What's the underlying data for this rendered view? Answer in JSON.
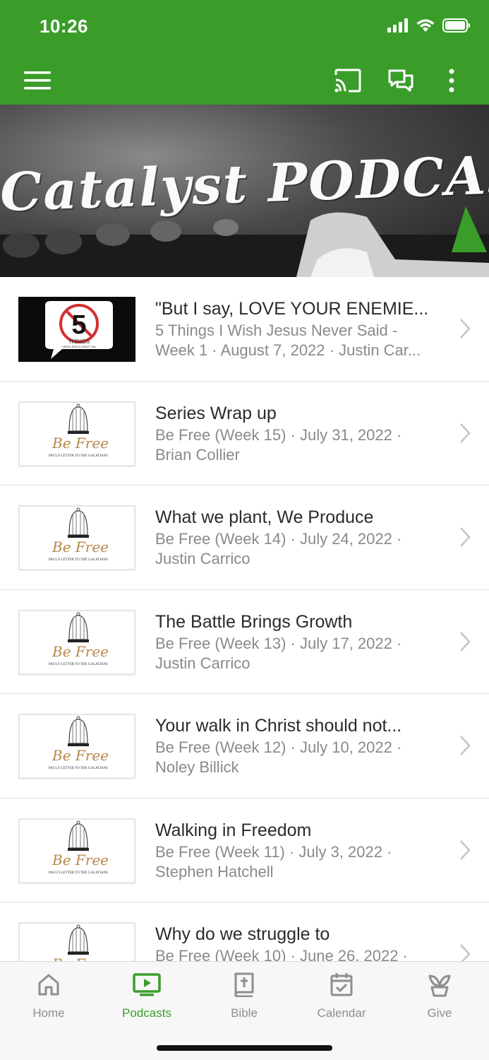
{
  "status": {
    "time": "10:26"
  },
  "appbar": {
    "menu_icon": "menu-icon",
    "cast_icon": "cast-icon",
    "chat_icon": "chat-icon",
    "more_icon": "more-vertical-icon",
    "color": "#3a9d2a"
  },
  "banner": {
    "title": "Catalyst PODCAST"
  },
  "episodes": [
    {
      "title": "\"But I say, LOVE YOUR ENEMIE...",
      "line1": "5 Things I Wish Jesus Never Said -",
      "line2": "Week 1 · August 7, 2022 · Justin Car...",
      "thumb": "five-things"
    },
    {
      "title": "Series Wrap up",
      "line1": "Be Free (Week 15) · July 31, 2022 ·",
      "line2": "Brian Collier",
      "thumb": "be-free"
    },
    {
      "title": "What we plant, We Produce",
      "line1": "Be Free (Week 14) · July 24, 2022 ·",
      "line2": "Justin Carrico",
      "thumb": "be-free"
    },
    {
      "title": "The Battle Brings Growth",
      "line1": "Be Free (Week 13) · July 17, 2022 ·",
      "line2": "Justin Carrico",
      "thumb": "be-free"
    },
    {
      "title": "Your walk in Christ should not...",
      "line1": "Be Free (Week 12) · July 10, 2022 ·",
      "line2": "Noley Billick",
      "thumb": "be-free"
    },
    {
      "title": "Walking in Freedom",
      "line1": "Be Free (Week 11) · July 3, 2022 ·",
      "line2": "Stephen Hatchell",
      "thumb": "be-free"
    },
    {
      "title": "Why do we struggle to",
      "line1": "Be Free (Week 10) · June 26, 2022 ·",
      "line2": "",
      "thumb": "be-free"
    }
  ],
  "thumbs": {
    "five_things_number": "5",
    "five_things_word": "THINGS",
    "five_things_caption": "I WISH JESUS DIDN'T SAY",
    "be_free_title": "Be Free",
    "be_free_caption": "PAUL'S LETTER TO THE GALATIANS"
  },
  "tabs": [
    {
      "label": "Home",
      "icon": "home-icon",
      "active": false
    },
    {
      "label": "Podcasts",
      "icon": "tv-play-icon",
      "active": true
    },
    {
      "label": "Bible",
      "icon": "bible-icon",
      "active": false
    },
    {
      "label": "Calendar",
      "icon": "calendar-check-icon",
      "active": false
    },
    {
      "label": "Give",
      "icon": "plant-icon",
      "active": false
    }
  ],
  "colors": {
    "accent": "#3a9d2a",
    "inactive": "#8e8e8e"
  }
}
